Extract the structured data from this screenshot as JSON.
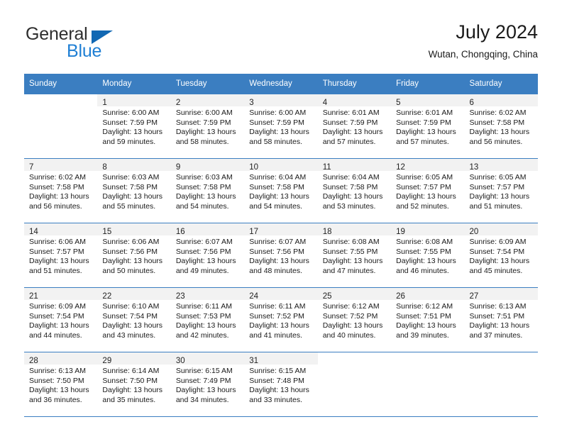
{
  "brand": {
    "name_part1": "General",
    "name_part2": "Blue"
  },
  "header": {
    "month_title": "July 2024",
    "location": "Wutan, Chongqing, China"
  },
  "colors": {
    "header_blue": "#3b7ec1",
    "brand_blue": "#1f7fd4",
    "triangle_blue": "#1268b3",
    "daynum_band": "#f2f2f2"
  },
  "weekday_headers": [
    "Sunday",
    "Monday",
    "Tuesday",
    "Wednesday",
    "Thursday",
    "Friday",
    "Saturday"
  ],
  "weeks": [
    [
      {
        "day": "",
        "sunrise": "",
        "sunset": "",
        "daylight_line1": "",
        "daylight_line2": ""
      },
      {
        "day": "1",
        "sunrise": "Sunrise: 6:00 AM",
        "sunset": "Sunset: 7:59 PM",
        "daylight_line1": "Daylight: 13 hours",
        "daylight_line2": "and 59 minutes."
      },
      {
        "day": "2",
        "sunrise": "Sunrise: 6:00 AM",
        "sunset": "Sunset: 7:59 PM",
        "daylight_line1": "Daylight: 13 hours",
        "daylight_line2": "and 58 minutes."
      },
      {
        "day": "3",
        "sunrise": "Sunrise: 6:00 AM",
        "sunset": "Sunset: 7:59 PM",
        "daylight_line1": "Daylight: 13 hours",
        "daylight_line2": "and 58 minutes."
      },
      {
        "day": "4",
        "sunrise": "Sunrise: 6:01 AM",
        "sunset": "Sunset: 7:59 PM",
        "daylight_line1": "Daylight: 13 hours",
        "daylight_line2": "and 57 minutes."
      },
      {
        "day": "5",
        "sunrise": "Sunrise: 6:01 AM",
        "sunset": "Sunset: 7:59 PM",
        "daylight_line1": "Daylight: 13 hours",
        "daylight_line2": "and 57 minutes."
      },
      {
        "day": "6",
        "sunrise": "Sunrise: 6:02 AM",
        "sunset": "Sunset: 7:58 PM",
        "daylight_line1": "Daylight: 13 hours",
        "daylight_line2": "and 56 minutes."
      }
    ],
    [
      {
        "day": "7",
        "sunrise": "Sunrise: 6:02 AM",
        "sunset": "Sunset: 7:58 PM",
        "daylight_line1": "Daylight: 13 hours",
        "daylight_line2": "and 56 minutes."
      },
      {
        "day": "8",
        "sunrise": "Sunrise: 6:03 AM",
        "sunset": "Sunset: 7:58 PM",
        "daylight_line1": "Daylight: 13 hours",
        "daylight_line2": "and 55 minutes."
      },
      {
        "day": "9",
        "sunrise": "Sunrise: 6:03 AM",
        "sunset": "Sunset: 7:58 PM",
        "daylight_line1": "Daylight: 13 hours",
        "daylight_line2": "and 54 minutes."
      },
      {
        "day": "10",
        "sunrise": "Sunrise: 6:04 AM",
        "sunset": "Sunset: 7:58 PM",
        "daylight_line1": "Daylight: 13 hours",
        "daylight_line2": "and 54 minutes."
      },
      {
        "day": "11",
        "sunrise": "Sunrise: 6:04 AM",
        "sunset": "Sunset: 7:58 PM",
        "daylight_line1": "Daylight: 13 hours",
        "daylight_line2": "and 53 minutes."
      },
      {
        "day": "12",
        "sunrise": "Sunrise: 6:05 AM",
        "sunset": "Sunset: 7:57 PM",
        "daylight_line1": "Daylight: 13 hours",
        "daylight_line2": "and 52 minutes."
      },
      {
        "day": "13",
        "sunrise": "Sunrise: 6:05 AM",
        "sunset": "Sunset: 7:57 PM",
        "daylight_line1": "Daylight: 13 hours",
        "daylight_line2": "and 51 minutes."
      }
    ],
    [
      {
        "day": "14",
        "sunrise": "Sunrise: 6:06 AM",
        "sunset": "Sunset: 7:57 PM",
        "daylight_line1": "Daylight: 13 hours",
        "daylight_line2": "and 51 minutes."
      },
      {
        "day": "15",
        "sunrise": "Sunrise: 6:06 AM",
        "sunset": "Sunset: 7:56 PM",
        "daylight_line1": "Daylight: 13 hours",
        "daylight_line2": "and 50 minutes."
      },
      {
        "day": "16",
        "sunrise": "Sunrise: 6:07 AM",
        "sunset": "Sunset: 7:56 PM",
        "daylight_line1": "Daylight: 13 hours",
        "daylight_line2": "and 49 minutes."
      },
      {
        "day": "17",
        "sunrise": "Sunrise: 6:07 AM",
        "sunset": "Sunset: 7:56 PM",
        "daylight_line1": "Daylight: 13 hours",
        "daylight_line2": "and 48 minutes."
      },
      {
        "day": "18",
        "sunrise": "Sunrise: 6:08 AM",
        "sunset": "Sunset: 7:55 PM",
        "daylight_line1": "Daylight: 13 hours",
        "daylight_line2": "and 47 minutes."
      },
      {
        "day": "19",
        "sunrise": "Sunrise: 6:08 AM",
        "sunset": "Sunset: 7:55 PM",
        "daylight_line1": "Daylight: 13 hours",
        "daylight_line2": "and 46 minutes."
      },
      {
        "day": "20",
        "sunrise": "Sunrise: 6:09 AM",
        "sunset": "Sunset: 7:54 PM",
        "daylight_line1": "Daylight: 13 hours",
        "daylight_line2": "and 45 minutes."
      }
    ],
    [
      {
        "day": "21",
        "sunrise": "Sunrise: 6:09 AM",
        "sunset": "Sunset: 7:54 PM",
        "daylight_line1": "Daylight: 13 hours",
        "daylight_line2": "and 44 minutes."
      },
      {
        "day": "22",
        "sunrise": "Sunrise: 6:10 AM",
        "sunset": "Sunset: 7:54 PM",
        "daylight_line1": "Daylight: 13 hours",
        "daylight_line2": "and 43 minutes."
      },
      {
        "day": "23",
        "sunrise": "Sunrise: 6:11 AM",
        "sunset": "Sunset: 7:53 PM",
        "daylight_line1": "Daylight: 13 hours",
        "daylight_line2": "and 42 minutes."
      },
      {
        "day": "24",
        "sunrise": "Sunrise: 6:11 AM",
        "sunset": "Sunset: 7:52 PM",
        "daylight_line1": "Daylight: 13 hours",
        "daylight_line2": "and 41 minutes."
      },
      {
        "day": "25",
        "sunrise": "Sunrise: 6:12 AM",
        "sunset": "Sunset: 7:52 PM",
        "daylight_line1": "Daylight: 13 hours",
        "daylight_line2": "and 40 minutes."
      },
      {
        "day": "26",
        "sunrise": "Sunrise: 6:12 AM",
        "sunset": "Sunset: 7:51 PM",
        "daylight_line1": "Daylight: 13 hours",
        "daylight_line2": "and 39 minutes."
      },
      {
        "day": "27",
        "sunrise": "Sunrise: 6:13 AM",
        "sunset": "Sunset: 7:51 PM",
        "daylight_line1": "Daylight: 13 hours",
        "daylight_line2": "and 37 minutes."
      }
    ],
    [
      {
        "day": "28",
        "sunrise": "Sunrise: 6:13 AM",
        "sunset": "Sunset: 7:50 PM",
        "daylight_line1": "Daylight: 13 hours",
        "daylight_line2": "and 36 minutes."
      },
      {
        "day": "29",
        "sunrise": "Sunrise: 6:14 AM",
        "sunset": "Sunset: 7:50 PM",
        "daylight_line1": "Daylight: 13 hours",
        "daylight_line2": "and 35 minutes."
      },
      {
        "day": "30",
        "sunrise": "Sunrise: 6:15 AM",
        "sunset": "Sunset: 7:49 PM",
        "daylight_line1": "Daylight: 13 hours",
        "daylight_line2": "and 34 minutes."
      },
      {
        "day": "31",
        "sunrise": "Sunrise: 6:15 AM",
        "sunset": "Sunset: 7:48 PM",
        "daylight_line1": "Daylight: 13 hours",
        "daylight_line2": "and 33 minutes."
      },
      {
        "day": "",
        "sunrise": "",
        "sunset": "",
        "daylight_line1": "",
        "daylight_line2": ""
      },
      {
        "day": "",
        "sunrise": "",
        "sunset": "",
        "daylight_line1": "",
        "daylight_line2": ""
      },
      {
        "day": "",
        "sunrise": "",
        "sunset": "",
        "daylight_line1": "",
        "daylight_line2": ""
      }
    ]
  ]
}
